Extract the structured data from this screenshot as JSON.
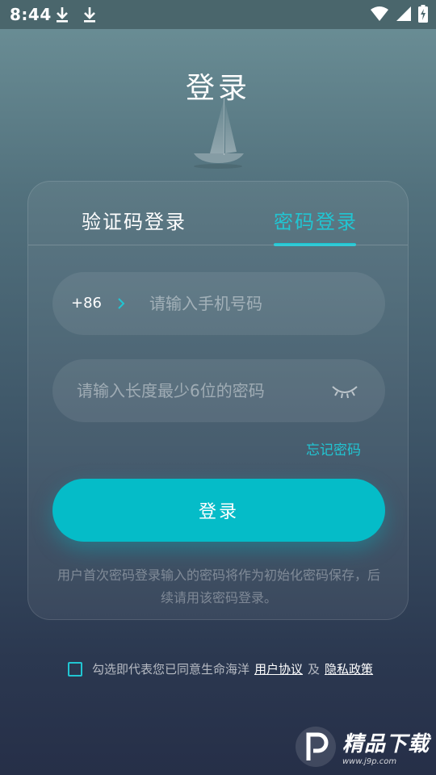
{
  "status_bar": {
    "time": "8:44",
    "icons": [
      "download-icon",
      "download-icon",
      "wifi-icon",
      "signal-icon",
      "battery-charging-icon"
    ]
  },
  "header": {
    "title": "登录",
    "illustration": "sailboat-icon"
  },
  "tabs": [
    {
      "label": "验证码登录",
      "active": false
    },
    {
      "label": "密码登录",
      "active": true
    }
  ],
  "form": {
    "country_code": "+86",
    "phone_placeholder": "请输入手机号码",
    "password_placeholder": "请输入长度最少6位的密码",
    "password_visibility_icon": "eye-closed-icon",
    "forgot_password": "忘记密码",
    "login_button": "登录",
    "note": "用户首次密码登录输入的密码将作为初始化密码保存，后续请用该密码登录。"
  },
  "agreement": {
    "checked": false,
    "text": "勾选即代表您已同意生命海洋",
    "user_agreement": "用户协议",
    "and": "及",
    "privacy_policy": "隐私政策"
  },
  "watermark": {
    "brand": "精品下载",
    "url": "www.j9p.com"
  },
  "colors": {
    "accent": "#21c5d2",
    "button": "#05bcc8",
    "status_bar": "#4a666c"
  }
}
